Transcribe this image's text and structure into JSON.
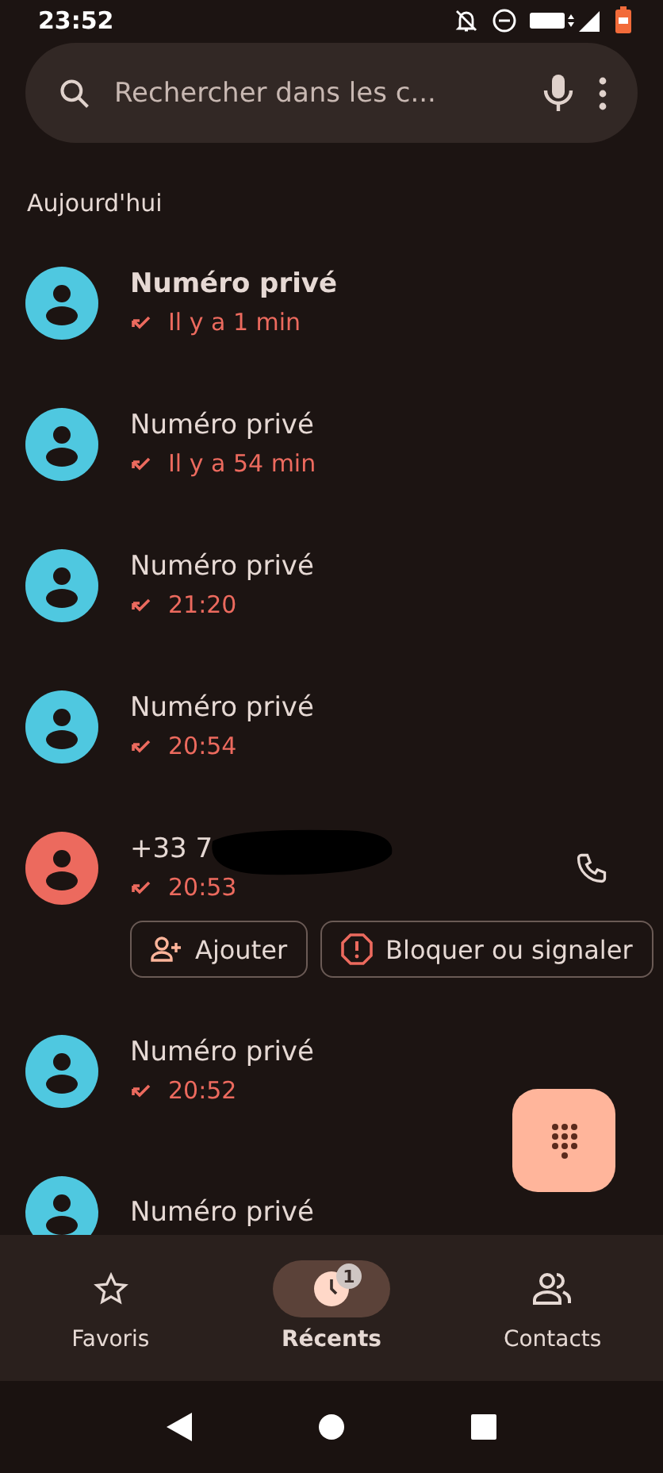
{
  "status_bar": {
    "time": "23:52"
  },
  "search": {
    "placeholder": "Rechercher dans les c..."
  },
  "section": "Aujourd'hui",
  "calls": [
    {
      "name": "Numéro privé",
      "time": "Il y a 1 min",
      "unread": true,
      "color": "#4fc8e0",
      "expanded": false
    },
    {
      "name": "Numéro privé",
      "time": "Il y a 54 min",
      "unread": false,
      "color": "#4fc8e0",
      "expanded": false
    },
    {
      "name": "Numéro privé",
      "time": "21:20",
      "unread": false,
      "color": "#4fc8e0",
      "expanded": false
    },
    {
      "name": "Numéro privé",
      "time": "20:54",
      "unread": false,
      "color": "#4fc8e0",
      "expanded": false
    },
    {
      "name": "+33 7",
      "time": "20:53",
      "unread": false,
      "color": "#ec6a5e",
      "expanded": true,
      "redacted": true,
      "actions": [
        {
          "kind": "add",
          "label": "Ajouter"
        },
        {
          "kind": "block",
          "label": "Bloquer ou signaler"
        }
      ]
    },
    {
      "name": "Numéro privé",
      "time": "20:52",
      "unread": false,
      "color": "#4fc8e0",
      "expanded": false
    },
    {
      "name": "Numéro privé",
      "unread": false,
      "color": "#4fc8e0",
      "expanded": false
    }
  ],
  "tabs": [
    {
      "kind": "star",
      "label": "Favoris",
      "selected": false
    },
    {
      "kind": "recent",
      "label": "Récents",
      "selected": true,
      "badge": "1"
    },
    {
      "kind": "people",
      "label": "Contacts",
      "selected": false
    }
  ]
}
